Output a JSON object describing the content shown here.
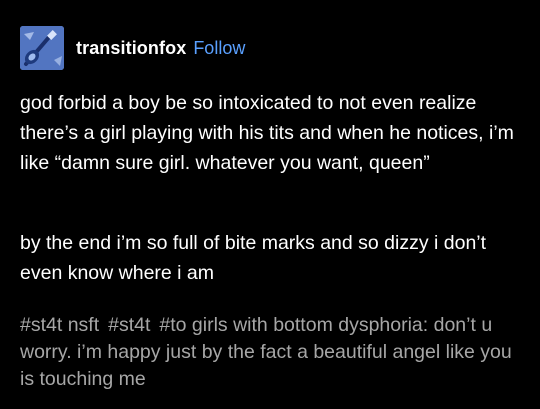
{
  "post": {
    "author": {
      "username": "transitionfox",
      "follow_label": "Follow",
      "avatar_icon": "guitar-avatar-icon"
    },
    "paragraphs": [
      "god forbid a boy be so intoxicated to not even realize there’s a girl playing with his tits and when he notices, i’m like “damn sure girl. whatever you want, queen”",
      "by the end i’m so full of bite marks and so dizzy i don’t even know where i am"
    ],
    "tags": [
      "#st4t nsft",
      "#st4t",
      "#to girls with bottom dysphoria: don’t u worry. i’m happy just by the fact a beautiful angel like you is touching me"
    ]
  },
  "colors": {
    "background": "#000000",
    "text": "#ffffff",
    "follow": "#5aa0ff",
    "tags": "#a6a6a6",
    "avatar_bg": "#6a8fd8"
  }
}
